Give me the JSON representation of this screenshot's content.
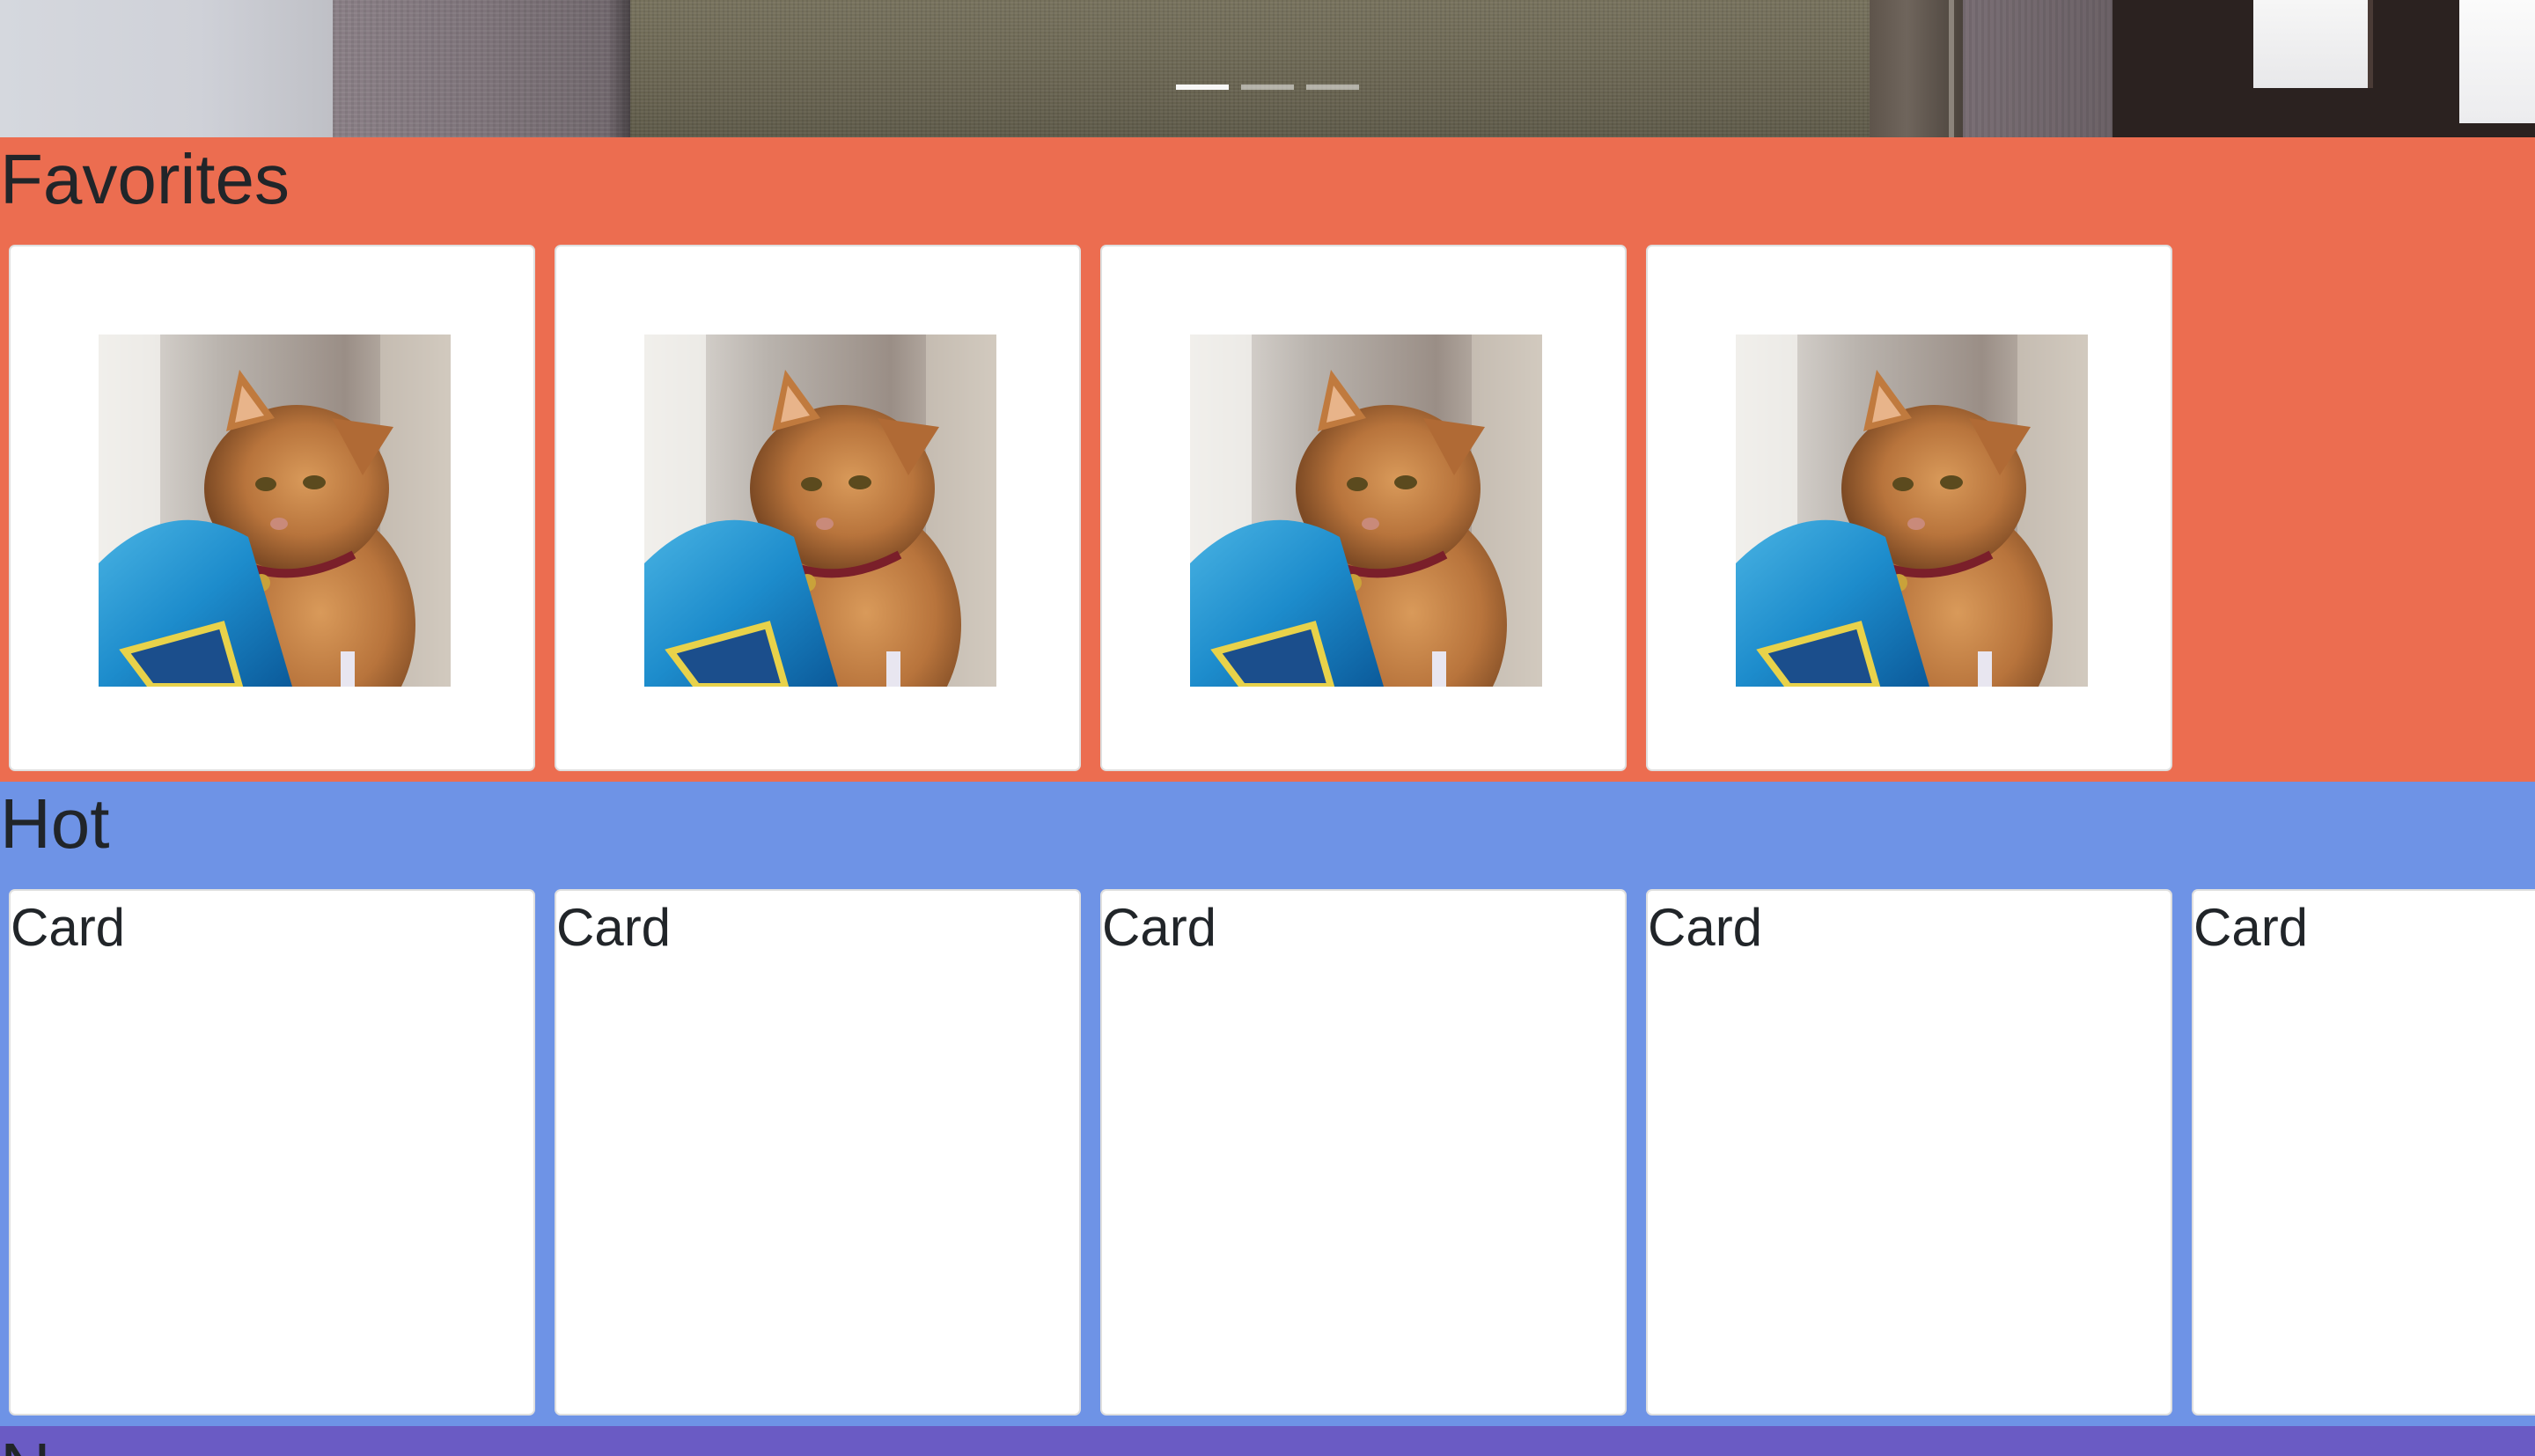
{
  "carousel": {
    "indicators": [
      "slide-1",
      "slide-2",
      "slide-3"
    ],
    "active_index": 0
  },
  "sections": {
    "favorites": {
      "title": "Favorites",
      "color": "#ec6d50",
      "card_image": "cat-photo"
    },
    "hot": {
      "title": "Hot",
      "color": "#6e93e6",
      "cards": [
        "Card",
        "Card",
        "Card",
        "Card",
        "Card"
      ]
    },
    "new": {
      "title": "N",
      "color": "#6a5bc4"
    }
  }
}
